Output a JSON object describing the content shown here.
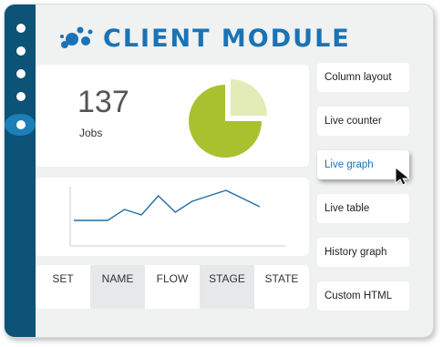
{
  "app": {
    "title": "CLIENT MODULE"
  },
  "sidebar": {
    "dots": 5,
    "active_index": 4
  },
  "stats": {
    "value": "137",
    "label": "Jobs"
  },
  "pie": {
    "slices": [
      {
        "fraction": 0.75,
        "color": "#a9c12f"
      },
      {
        "fraction": 0.25,
        "color": "#e3ebb7"
      }
    ]
  },
  "line_chart": {
    "values": [
      12,
      12,
      12,
      20,
      16,
      30,
      18,
      26,
      30,
      34,
      28,
      22
    ]
  },
  "table": {
    "columns": [
      "SET",
      "NAME",
      "FLOW",
      "STAGE",
      "STATE"
    ]
  },
  "menu": {
    "items": [
      "Column layout",
      "Live counter",
      "Live graph",
      "Live table",
      "History graph",
      "Custom HTML"
    ],
    "active_index": 2
  },
  "colors": {
    "sidebar": "#0d5277",
    "accent": "#1a73b5",
    "line": "#1e6ea8"
  }
}
